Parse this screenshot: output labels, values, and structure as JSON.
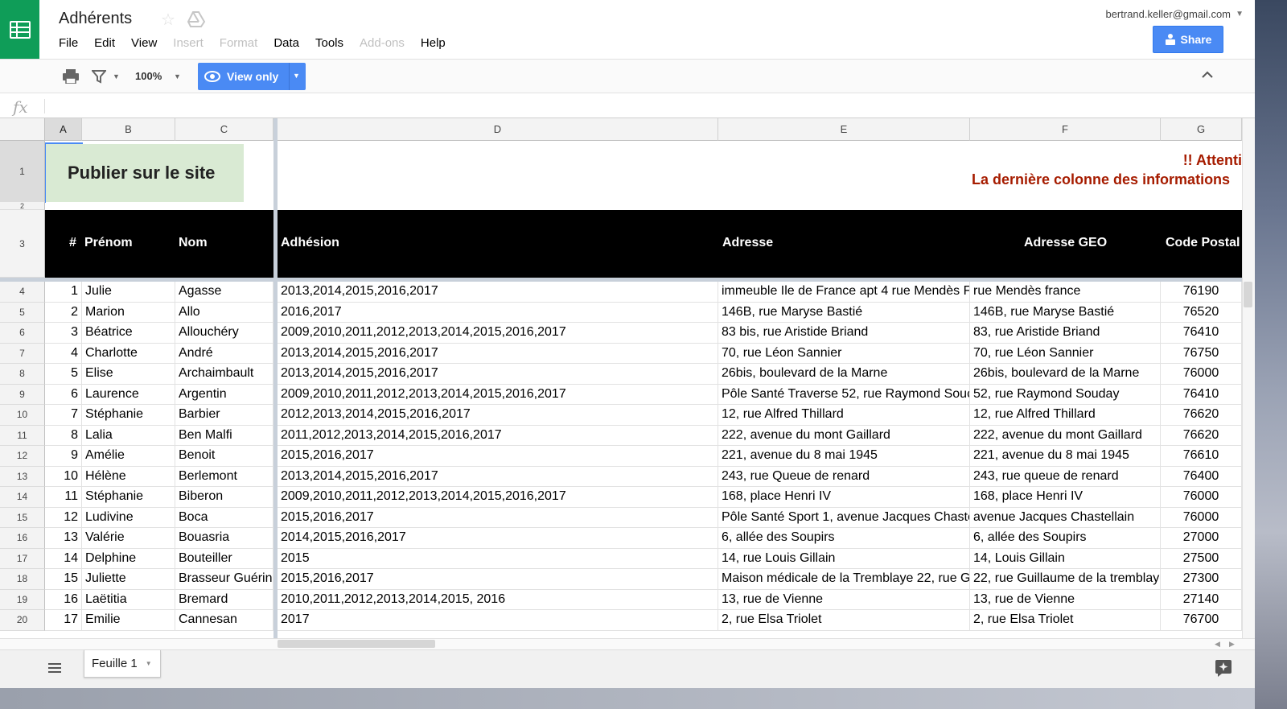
{
  "header": {
    "title": "Adhérents",
    "account": "bertrand.keller@gmail.com",
    "share_label": "Share",
    "menu": [
      {
        "label": "File",
        "enabled": true
      },
      {
        "label": "Edit",
        "enabled": true
      },
      {
        "label": "View",
        "enabled": true
      },
      {
        "label": "Insert",
        "enabled": false
      },
      {
        "label": "Format",
        "enabled": false
      },
      {
        "label": "Data",
        "enabled": true
      },
      {
        "label": "Tools",
        "enabled": true
      },
      {
        "label": "Add-ons",
        "enabled": false
      },
      {
        "label": "Help",
        "enabled": true
      }
    ]
  },
  "toolbar": {
    "zoom": "100%",
    "view_only_label": "View only"
  },
  "formula_bar": {
    "fx_label": "fx",
    "value": ""
  },
  "columns": [
    "A",
    "B",
    "C",
    "D",
    "E",
    "F",
    "G"
  ],
  "selected_column": "A",
  "top_rows": {
    "publish_button": "Publier sur le site",
    "warning_line1": "!! Attenti",
    "warning_line2": "La dernière colonne des informations"
  },
  "table": {
    "headers": {
      "num": "#",
      "prenom": "Prénom",
      "nom": "Nom",
      "adhesion": "Adhésion",
      "adresse": "Adresse",
      "adresse_geo": "Adresse GEO",
      "code_postal": "Code Postal"
    },
    "rows": [
      {
        "num": "1",
        "prenom": "Julie",
        "nom": "Agasse",
        "adhesion": "2013,2014,2015,2016,2017",
        "adresse": "immeuble Ile de France apt 4 rue Mendès F",
        "adresse_geo": "rue Mendès france",
        "code_postal": "76190"
      },
      {
        "num": "2",
        "prenom": "Marion",
        "nom": "Allo",
        "adhesion": "2016,2017",
        "adresse": "146B, rue Maryse Bastié",
        "adresse_geo": "146B, rue Maryse Bastié",
        "code_postal": "76520"
      },
      {
        "num": "3",
        "prenom": "Béatrice",
        "nom": "Allouchéry",
        "adhesion": "2009,2010,2011,2012,2013,2014,2015,2016,2017",
        "adresse": "83 bis, rue Aristide Briand",
        "adresse_geo": "83, rue Aristide Briand",
        "code_postal": "76410"
      },
      {
        "num": "4",
        "prenom": "Charlotte",
        "nom": "André",
        "adhesion": "2013,2014,2015,2016,2017",
        "adresse": "70, rue Léon Sannier",
        "adresse_geo": "70, rue Léon Sannier",
        "code_postal": "76750"
      },
      {
        "num": "5",
        "prenom": "Elise",
        "nom": "Archaimbault",
        "adhesion": "2013,2014,2015,2016,2017",
        "adresse": "26bis, boulevard de la Marne",
        "adresse_geo": "26bis, boulevard de la Marne",
        "code_postal": "76000"
      },
      {
        "num": "6",
        "prenom": "Laurence",
        "nom": "Argentin",
        "adhesion": "2009,2010,2011,2012,2013,2014,2015,2016,2017",
        "adresse": "Pôle Santé Traverse 52, rue Raymond Souc",
        "adresse_geo": "52, rue Raymond Souday",
        "code_postal": "76410"
      },
      {
        "num": "7",
        "prenom": "Stéphanie",
        "nom": "Barbier",
        "adhesion": "2012,2013,2014,2015,2016,2017",
        "adresse": "12, rue Alfred Thillard",
        "adresse_geo": "12, rue Alfred Thillard",
        "code_postal": "76620"
      },
      {
        "num": "8",
        "prenom": "Lalia",
        "nom": "Ben Malfi",
        "adhesion": "2011,2012,2013,2014,2015,2016,2017",
        "adresse": "222, avenue du mont Gaillard",
        "adresse_geo": "222, avenue du mont Gaillard",
        "code_postal": "76620"
      },
      {
        "num": "9",
        "prenom": "Amélie",
        "nom": "Benoit",
        "adhesion": "2015,2016,2017",
        "adresse": "221, avenue du 8 mai 1945",
        "adresse_geo": "221, avenue du 8 mai 1945",
        "code_postal": "76610"
      },
      {
        "num": "10",
        "prenom": "Hélène",
        "nom": "Berlemont",
        "adhesion": "2013,2014,2015,2016,2017",
        "adresse": "243, rue Queue de renard",
        "adresse_geo": "243, rue queue de renard",
        "code_postal": "76400"
      },
      {
        "num": "11",
        "prenom": "Stéphanie",
        "nom": "Biberon",
        "adhesion": "2009,2010,2011,2012,2013,2014,2015,2016,2017",
        "adresse": "168, place Henri IV",
        "adresse_geo": "168, place Henri IV",
        "code_postal": "76000"
      },
      {
        "num": "12",
        "prenom": "Ludivine",
        "nom": "Boca",
        "adhesion": "2015,2016,2017",
        "adresse": "Pôle Santé Sport 1, avenue Jacques Chaste",
        "adresse_geo": "avenue Jacques Chastellain",
        "code_postal": "76000"
      },
      {
        "num": "13",
        "prenom": "Valérie",
        "nom": "Bouasria",
        "adhesion": "2014,2015,2016,2017",
        "adresse": "6, allée des Soupirs",
        "adresse_geo": "6, allée des Soupirs",
        "code_postal": "27000"
      },
      {
        "num": "14",
        "prenom": "Delphine",
        "nom": "Bouteiller",
        "adhesion": "2015",
        "adresse": "14, rue Louis Gillain",
        "adresse_geo": "14, Louis Gillain",
        "code_postal": "27500"
      },
      {
        "num": "15",
        "prenom": "Juliette",
        "nom": "Brasseur Guérin",
        "adhesion": "2015,2016,2017",
        "adresse": "Maison médicale de la Tremblaye 22, rue G",
        "adresse_geo": "22, rue Guillaume de la tremblaye",
        "code_postal": "27300"
      },
      {
        "num": "16",
        "prenom": "Laëtitia",
        "nom": "Bremard",
        "adhesion": "2010,2011,2012,2013,2014,2015, 2016",
        "adresse": "13, rue de Vienne",
        "adresse_geo": "13, rue de Vienne",
        "code_postal": "27140"
      },
      {
        "num": "17",
        "prenom": "Emilie",
        "nom": "Cannesan",
        "adhesion": "2017",
        "adresse": "2, rue Elsa Triolet",
        "adresse_geo": "2, rue Elsa Triolet",
        "code_postal": "76700"
      }
    ]
  },
  "row_numbers": [
    "1",
    "2",
    "3",
    "4",
    "5",
    "6",
    "7",
    "8",
    "9",
    "10",
    "11",
    "12",
    "13",
    "14",
    "15",
    "16",
    "17",
    "18",
    "19",
    "20"
  ],
  "sheet_tabs": [
    "Feuille 1"
  ]
}
